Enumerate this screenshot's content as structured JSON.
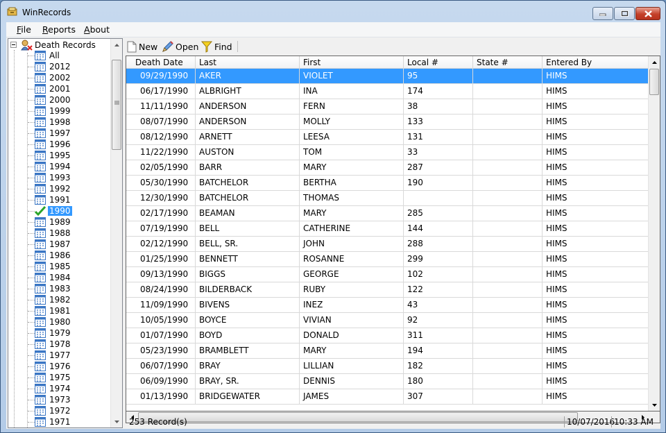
{
  "window": {
    "title": "WinRecords"
  },
  "menu": [
    {
      "label": "File",
      "mnemonic": "F",
      "rest": "ile"
    },
    {
      "label": "Reports",
      "mnemonic": "R",
      "rest": "eports"
    },
    {
      "label": "About",
      "mnemonic": "A",
      "rest": "bout"
    }
  ],
  "tree": {
    "root": "Death Records",
    "items": [
      "All",
      "2012",
      "2002",
      "2001",
      "2000",
      "1999",
      "1998",
      "1997",
      "1996",
      "1995",
      "1994",
      "1993",
      "1992",
      "1991",
      "1990",
      "1989",
      "1988",
      "1987",
      "1986",
      "1985",
      "1984",
      "1983",
      "1982",
      "1981",
      "1980",
      "1979",
      "1978",
      "1977",
      "1976",
      "1975",
      "1974",
      "1973",
      "1972",
      "1971"
    ],
    "selected": "1990"
  },
  "toolbar": {
    "new_label": "New",
    "open_label": "Open",
    "find_label": "Find"
  },
  "grid": {
    "columns": [
      "Death Date",
      "Last",
      "First",
      "Local #",
      "State #",
      "Entered By"
    ],
    "rows": [
      [
        "09/29/1990",
        "AKER",
        "VIOLET",
        "95",
        "",
        "HIMS"
      ],
      [
        "06/17/1990",
        "ALBRIGHT",
        "INA",
        "174",
        "",
        "HIMS"
      ],
      [
        "11/11/1990",
        "ANDERSON",
        "FERN",
        "38",
        "",
        "HIMS"
      ],
      [
        "08/07/1990",
        "ANDERSON",
        "MOLLY",
        "133",
        "",
        "HIMS"
      ],
      [
        "08/12/1990",
        "ARNETT",
        "LEESA",
        "131",
        "",
        "HIMS"
      ],
      [
        "11/22/1990",
        "AUSTON",
        "TOM",
        "33",
        "",
        "HIMS"
      ],
      [
        "02/05/1990",
        "BARR",
        "MARY",
        "287",
        "",
        "HIMS"
      ],
      [
        "05/30/1990",
        "BATCHELOR",
        "BERTHA",
        "190",
        "",
        "HIMS"
      ],
      [
        "12/30/1990",
        "BATCHELOR",
        "THOMAS",
        "",
        "",
        "HIMS"
      ],
      [
        "02/17/1990",
        "BEAMAN",
        "MARY",
        "285",
        "",
        "HIMS"
      ],
      [
        "07/19/1990",
        "BELL",
        "CATHERINE",
        "144",
        "",
        "HIMS"
      ],
      [
        "02/12/1990",
        "BELL, SR.",
        "JOHN",
        "288",
        "",
        "HIMS"
      ],
      [
        "01/25/1990",
        "BENNETT",
        "ROSANNE",
        "299",
        "",
        "HIMS"
      ],
      [
        "09/13/1990",
        "BIGGS",
        "GEORGE",
        "102",
        "",
        "HIMS"
      ],
      [
        "08/24/1990",
        "BILDERBACK",
        "RUBY",
        "122",
        "",
        "HIMS"
      ],
      [
        "11/09/1990",
        "BIVENS",
        "INEZ",
        "43",
        "",
        "HIMS"
      ],
      [
        "10/05/1990",
        "BOYCE",
        "VIVIAN",
        "92",
        "",
        "HIMS"
      ],
      [
        "01/07/1990",
        "BOYD",
        "DONALD",
        "311",
        "",
        "HIMS"
      ],
      [
        "05/23/1990",
        "BRAMBLETT",
        "MARY",
        "194",
        "",
        "HIMS"
      ],
      [
        "06/07/1990",
        "BRAY",
        "LILLIAN",
        "182",
        "",
        "HIMS"
      ],
      [
        "06/09/1990",
        "BRAY, SR.",
        "DENNIS",
        "180",
        "",
        "HIMS"
      ],
      [
        "01/13/1990",
        "BRIDGEWATER",
        "JAMES",
        "307",
        "",
        "HIMS"
      ]
    ],
    "selected_index": 0
  },
  "status": {
    "records": "253 Record(s)",
    "date": "10/07/2016",
    "time": "10:33 AM"
  },
  "colors": {
    "selection": "#3399ff",
    "tree_icon": "#3a76c4",
    "check": "#2aa52a"
  }
}
